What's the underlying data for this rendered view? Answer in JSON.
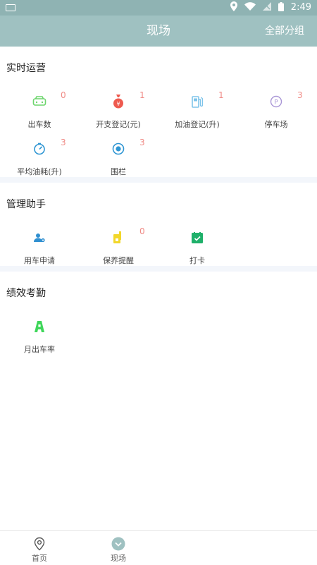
{
  "statusbar": {
    "time": "2:49"
  },
  "appbar": {
    "title": "现场",
    "action": "全部分组"
  },
  "sections": [
    {
      "title": "实时运营",
      "items": [
        {
          "label": "出车数",
          "count": "0"
        },
        {
          "label": "开支登记(元)",
          "count": "1"
        },
        {
          "label": "加油登记(升)",
          "count": "1"
        },
        {
          "label": "停车场",
          "count": "3"
        },
        {
          "label": "平均油耗(升)",
          "count": "3"
        },
        {
          "label": "围栏",
          "count": "3"
        }
      ]
    },
    {
      "title": "管理助手",
      "items": [
        {
          "label": "用车申请"
        },
        {
          "label": "保养提醒",
          "count": "0"
        },
        {
          "label": "打卡"
        }
      ]
    },
    {
      "title": "绩效考勤",
      "items": [
        {
          "label": "月出车率"
        }
      ]
    }
  ],
  "bottomnav": {
    "items": [
      {
        "label": "首页"
      },
      {
        "label": "现场"
      }
    ]
  },
  "colors": {
    "appbar": "#9fc1c1",
    "count": "#f08b86",
    "divider": "#f3f6fb"
  },
  "icons": {
    "car": "car-icon",
    "money_bag": "money-bag-icon",
    "fuel": "fuel-pump-icon",
    "parking": "parking-icon",
    "gauge": "fuel-gauge-icon",
    "fence": "fence-icon",
    "request": "user-request-icon",
    "maintenance": "maintenance-icon",
    "checkin": "checkin-icon",
    "rate": "rate-icon",
    "home": "location-pin-icon",
    "site": "site-check-icon"
  }
}
